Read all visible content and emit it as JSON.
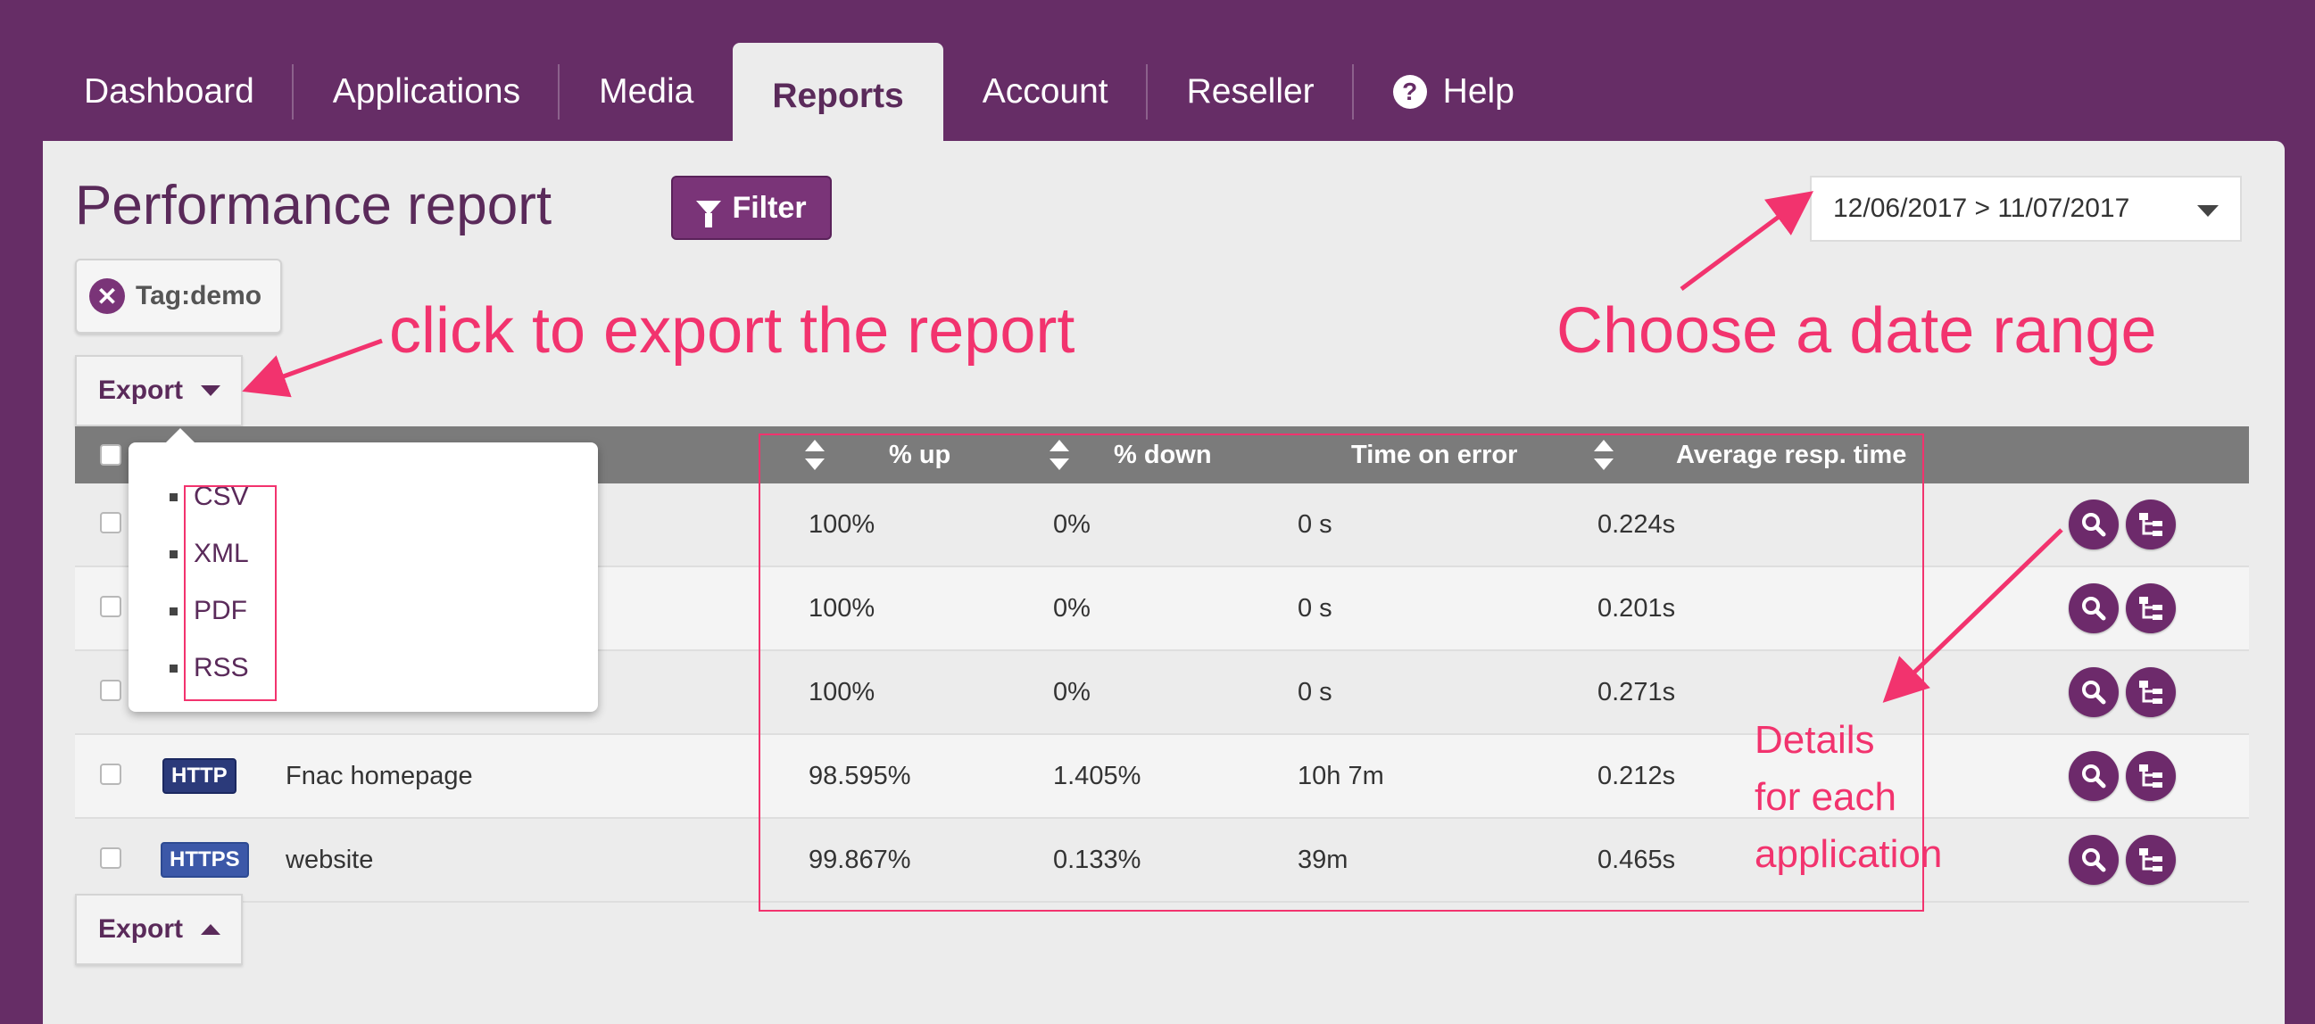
{
  "nav": {
    "tabs": [
      {
        "label": "Dashboard"
      },
      {
        "label": "Applications"
      },
      {
        "label": "Media"
      },
      {
        "label": "Reports"
      },
      {
        "label": "Account"
      },
      {
        "label": "Reseller"
      },
      {
        "label": "Help"
      }
    ],
    "active_tab": "Reports",
    "help_glyph": "?"
  },
  "page": {
    "title": "Performance report",
    "filter_label": "Filter",
    "date_range": "12/06/2017 > 11/07/2017",
    "tag_label": "Tag:demo",
    "tag_remove_glyph": "✕",
    "export_label": "Export"
  },
  "export_menu": {
    "items": [
      "CSV",
      "XML",
      "PDF",
      "RSS"
    ]
  },
  "table": {
    "columns": [
      "% up",
      "% down",
      "Time on error",
      "Average resp. time"
    ],
    "rows": [
      {
        "protocol": "",
        "name": "",
        "up": "100%",
        "down": "0%",
        "error_time": "0 s",
        "avg_resp": "0.224s"
      },
      {
        "protocol": "",
        "name": "",
        "up": "100%",
        "down": "0%",
        "error_time": "0 s",
        "avg_resp": "0.201s"
      },
      {
        "protocol": "",
        "name": "",
        "up": "100%",
        "down": "0%",
        "error_time": "0 s",
        "avg_resp": "0.271s"
      },
      {
        "protocol": "HTTP",
        "name": "Fnac homepage",
        "up": "98.595%",
        "down": "1.405%",
        "error_time": "10h 7m",
        "avg_resp": "0.212s"
      },
      {
        "protocol": "HTTPS",
        "name": "website",
        "up": "99.867%",
        "down": "0.133%",
        "error_time": "39m",
        "avg_resp": "0.465s"
      }
    ]
  },
  "annotations": {
    "export_hint": "click to export the report",
    "date_hint": "Choose a date range",
    "details_hint": [
      "Details",
      "for each",
      "application"
    ]
  },
  "colors": {
    "brand_purple": "#662d66",
    "annotation_pink": "#f2336e",
    "header_gray": "#7b7b7b"
  },
  "icons": {
    "details": "magnifier-icon",
    "tree": "hierarchy-icon"
  }
}
